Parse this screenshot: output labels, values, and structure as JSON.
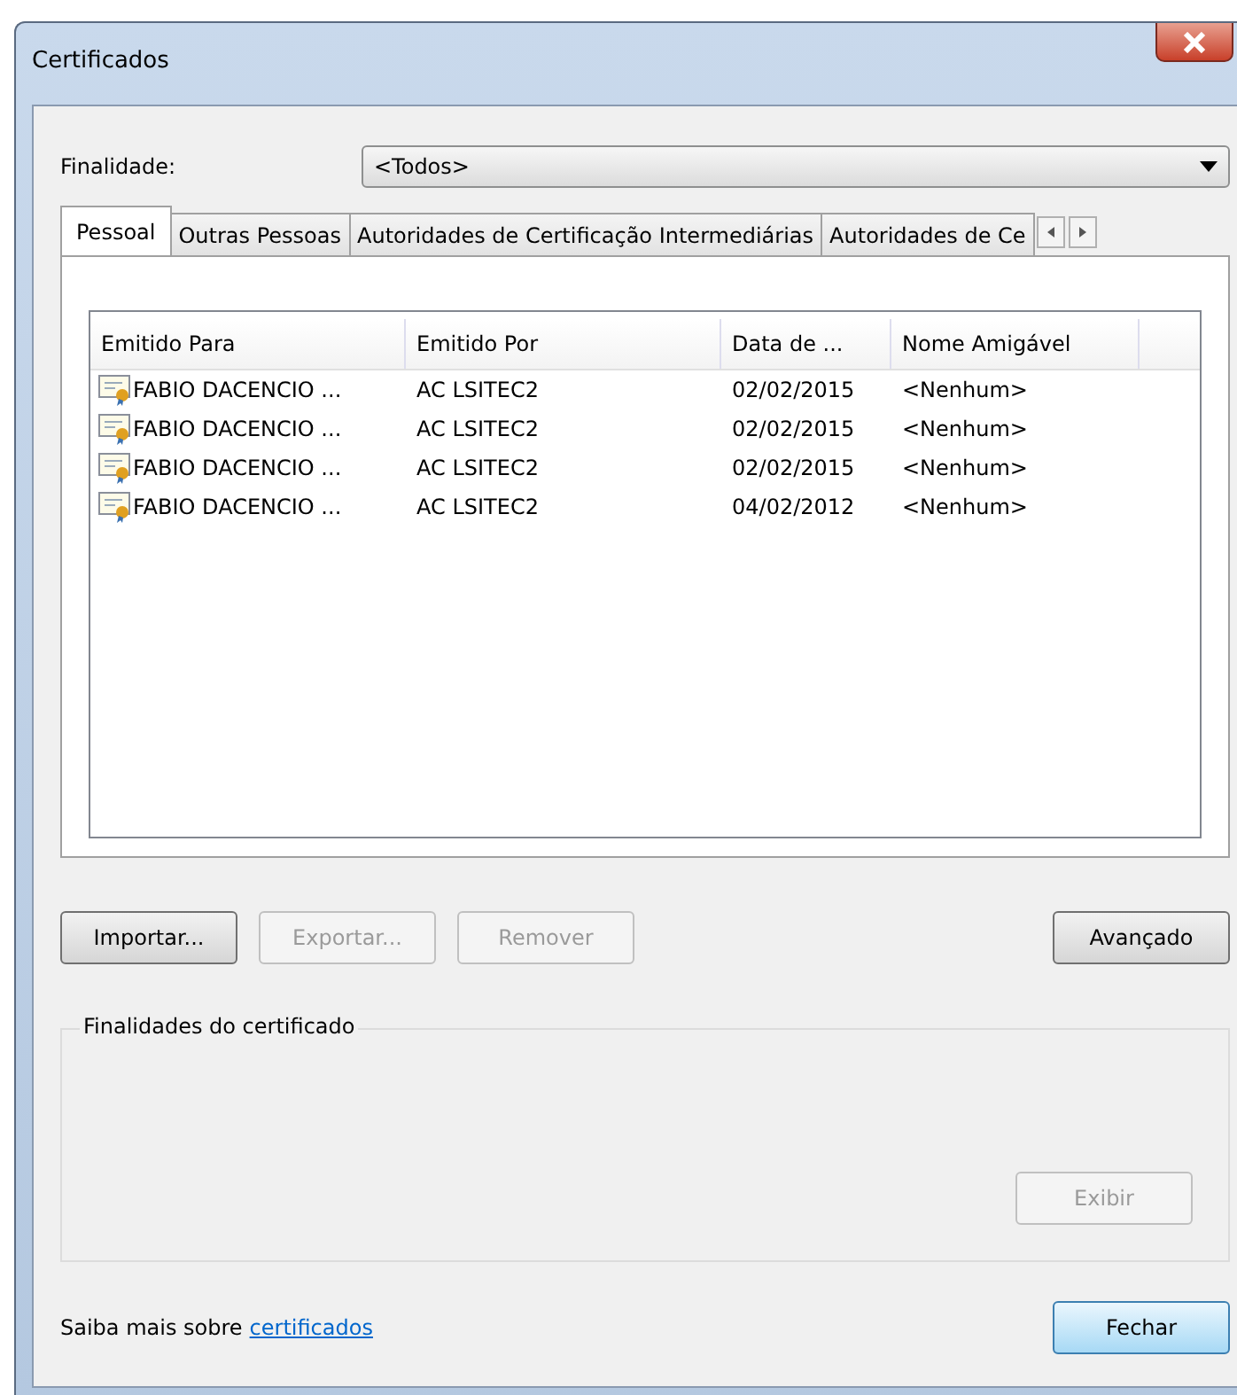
{
  "window": {
    "title": "Certificados"
  },
  "purpose": {
    "label": "Finalidade:",
    "value": "<Todos>"
  },
  "tabs": [
    {
      "label": "Pessoal",
      "selected": true
    },
    {
      "label": "Outras Pessoas",
      "selected": false
    },
    {
      "label": "Autoridades de Certificação Intermediárias",
      "selected": false
    },
    {
      "label": "Autoridades de Ce",
      "selected": false
    }
  ],
  "table": {
    "columns": [
      "Emitido Para",
      "Emitido Por",
      "Data de ...",
      "Nome Amigável"
    ],
    "rows": [
      [
        "FABIO DACENCIO ...",
        "AC LSITEC2",
        "02/02/2015",
        "<Nenhum>"
      ],
      [
        "FABIO DACENCIO ...",
        "AC LSITEC2",
        "02/02/2015",
        "<Nenhum>"
      ],
      [
        "FABIO DACENCIO ...",
        "AC LSITEC2",
        "02/02/2015",
        "<Nenhum>"
      ],
      [
        "FABIO DACENCIO ...",
        "AC LSITEC2",
        "04/02/2012",
        "<Nenhum>"
      ]
    ]
  },
  "actions": [
    {
      "label": "Importar...",
      "disabled": false
    },
    {
      "label": "Exportar...",
      "disabled": true
    },
    {
      "label": "Remover",
      "disabled": true
    }
  ],
  "advanced_button": {
    "label": "Avançado",
    "disabled": false
  },
  "purposes_group": {
    "title": "Finalidades do certificado",
    "view_button": {
      "label": "Exibir",
      "disabled": true
    }
  },
  "footer": {
    "text": "Saiba mais sobre",
    "link": "certificados",
    "close_button": {
      "label": "Fechar",
      "disabled": false
    }
  }
}
